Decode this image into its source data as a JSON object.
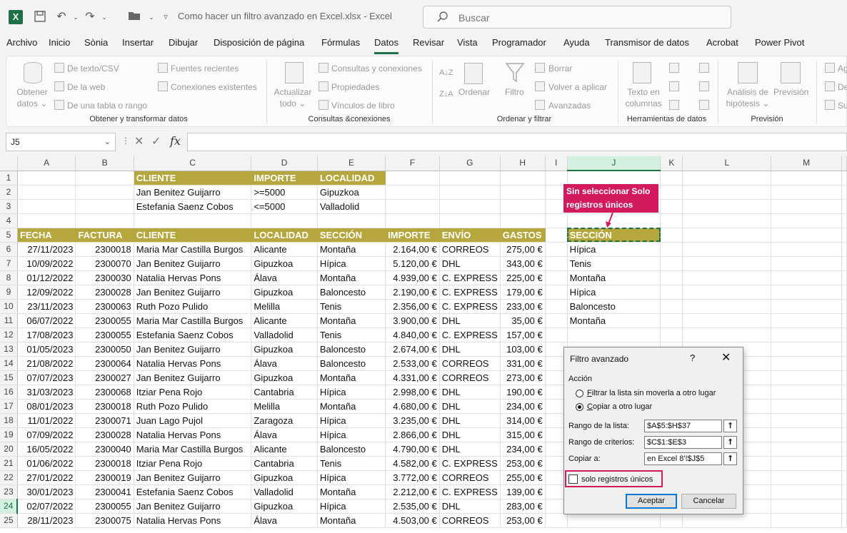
{
  "window": {
    "title": "Como hacer un filtro avanzado en Excel.xlsx  -  Excel",
    "search_placeholder": "Buscar"
  },
  "menu": [
    "Archivo",
    "Inicio",
    "Sònia",
    "Insertar",
    "Dibujar",
    "Disposición de página",
    "Fórmulas",
    "Datos",
    "Revisar",
    "Vista",
    "Programador",
    "Ayuda",
    "Transmisor de datos",
    "Acrobat",
    "Power Pivot"
  ],
  "menu_active": "Datos",
  "ribbon": {
    "obtener_datos_1": "Obtener",
    "obtener_datos_2": "datos ⌄",
    "de_texto": "De texto/CSV",
    "de_la_web": "De la web",
    "de_tabla": "De una tabla o rango",
    "fuentes_recientes": "Fuentes recientes",
    "conexiones_existentes": "Conexiones existentes",
    "group_obtener": "Obtener y transformar datos",
    "actualizar_1": "Actualizar",
    "actualizar_2": "todo ⌄",
    "consultas_conexiones": "Consultas y conexiones",
    "propiedades": "Propiedades",
    "vinculos": "Vínculos de libro",
    "group_consultas": "Consultas &conexiones",
    "ordenar": "Ordenar",
    "filtro": "Filtro",
    "borrar": "Borrar",
    "volver_aplicar": "Volver a aplicar",
    "avanzadas": "Avanzadas",
    "group_ordenar": "Ordenar y filtrar",
    "texto_columnas_1": "Texto en",
    "texto_columnas_2": "columnas",
    "group_herramientas": "Herramientas de datos",
    "analisis_1": "Análisis de",
    "analisis_2": "hipótesis ⌄",
    "prevision": "Previsión",
    "group_prevision": "Previsión",
    "ag": "Ag",
    "de": "De",
    "su": "Su"
  },
  "formula_bar": {
    "name_box": "J5",
    "fx": "fx",
    "formula": ""
  },
  "columns": [
    "A",
    "B",
    "C",
    "D",
    "E",
    "F",
    "G",
    "H",
    "I",
    "J",
    "K",
    "L",
    "M"
  ],
  "selected_column": "J",
  "selected_row": "24",
  "rows": [
    {
      "n": "1",
      "cells": [
        "",
        "",
        "CLIENTE",
        "IMPORTE",
        "LOCALIDAD",
        "",
        "",
        "",
        "",
        "",
        "",
        "",
        ""
      ]
    },
    {
      "n": "2",
      "cells": [
        "",
        "",
        "Jan Benitez Guijarro",
        ">=5000",
        "Gipuzkoa",
        "",
        "",
        "",
        "",
        "",
        "",
        "",
        ""
      ]
    },
    {
      "n": "3",
      "cells": [
        "",
        "",
        "Estefania Saenz Cobos",
        "<=5000",
        "Valladolid",
        "",
        "",
        "",
        "",
        "",
        "",
        "",
        ""
      ]
    },
    {
      "n": "4",
      "cells": [
        "",
        "",
        "",
        "",
        "",
        "",
        "",
        "",
        "",
        "",
        "",
        "",
        ""
      ]
    },
    {
      "n": "5",
      "cells": [
        "FECHA",
        "FACTURA",
        "CLIENTE",
        "LOCALIDAD",
        "SECCIÓN",
        "IMPORTE",
        "ENVÍO",
        "GASTOS",
        "",
        "SECCIÓN",
        "",
        "",
        ""
      ]
    },
    {
      "n": "6",
      "cells": [
        "27/11/2023",
        "2300018",
        "Maria Mar Castilla Burgos",
        "Alicante",
        "Montaña",
        "2.164,00 €",
        "CORREOS",
        "275,00 €",
        "",
        "Hípica",
        "",
        "",
        ""
      ]
    },
    {
      "n": "7",
      "cells": [
        "10/09/2022",
        "2300070",
        "Jan Benitez Guijarro",
        "Gipuzkoa",
        "Hípica",
        "5.120,00 €",
        "DHL",
        "343,00 €",
        "",
        "Tenis",
        "",
        "",
        ""
      ]
    },
    {
      "n": "8",
      "cells": [
        "01/12/2022",
        "2300030",
        "Natalia Hervas Pons",
        "Álava",
        "Montaña",
        "4.939,00 €",
        "C. EXPRESS",
        "225,00 €",
        "",
        "Montaña",
        "",
        "",
        ""
      ]
    },
    {
      "n": "9",
      "cells": [
        "12/09/2022",
        "2300028",
        "Jan Benitez Guijarro",
        "Gipuzkoa",
        "Baloncesto",
        "2.190,00 €",
        "C. EXPRESS",
        "179,00 €",
        "",
        "Hípica",
        "",
        "",
        ""
      ]
    },
    {
      "n": "10",
      "cells": [
        "23/11/2023",
        "2300063",
        "Ruth Pozo Pulido",
        "Melilla",
        "Tenis",
        "2.356,00 €",
        "C. EXPRESS",
        "233,00 €",
        "",
        "Baloncesto",
        "",
        "",
        ""
      ]
    },
    {
      "n": "11",
      "cells": [
        "06/07/2022",
        "2300055",
        "Maria Mar Castilla Burgos",
        "Alicante",
        "Montaña",
        "3.900,00 €",
        "DHL",
        "35,00 €",
        "",
        "Montaña",
        "",
        "",
        ""
      ]
    },
    {
      "n": "12",
      "cells": [
        "17/08/2023",
        "2300055",
        "Estefania Saenz Cobos",
        "Valladolid",
        "Tenis",
        "4.840,00 €",
        "C. EXPRESS",
        "157,00 €",
        "",
        "",
        "",
        "",
        ""
      ]
    },
    {
      "n": "13",
      "cells": [
        "01/05/2023",
        "2300050",
        "Jan Benitez Guijarro",
        "Gipuzkoa",
        "Baloncesto",
        "2.674,00 €",
        "DHL",
        "103,00 €",
        "",
        "",
        "",
        "",
        ""
      ]
    },
    {
      "n": "14",
      "cells": [
        "21/08/2022",
        "2300064",
        "Natalia Hervas Pons",
        "Álava",
        "Baloncesto",
        "2.533,00 €",
        "CORREOS",
        "331,00 €",
        "",
        "",
        "",
        "",
        ""
      ]
    },
    {
      "n": "15",
      "cells": [
        "07/07/2023",
        "2300027",
        "Jan Benitez Guijarro",
        "Gipuzkoa",
        "Montaña",
        "4.331,00 €",
        "CORREOS",
        "273,00 €",
        "",
        "",
        "",
        "",
        ""
      ]
    },
    {
      "n": "16",
      "cells": [
        "31/03/2023",
        "2300068",
        "Itziar Pena Rojo",
        "Cantabria",
        "Hípica",
        "2.998,00 €",
        "DHL",
        "190,00 €",
        "",
        "",
        "",
        "",
        ""
      ]
    },
    {
      "n": "17",
      "cells": [
        "08/01/2023",
        "2300018",
        "Ruth Pozo Pulido",
        "Melilla",
        "Montaña",
        "4.680,00 €",
        "DHL",
        "234,00 €",
        "",
        "",
        "",
        "",
        ""
      ]
    },
    {
      "n": "18",
      "cells": [
        "11/01/2022",
        "2300071",
        "Juan Lago Pujol",
        "Zaragoza",
        "Hípica",
        "3.235,00 €",
        "DHL",
        "314,00 €",
        "",
        "",
        "",
        "",
        ""
      ]
    },
    {
      "n": "19",
      "cells": [
        "07/09/2022",
        "2300028",
        "Natalia Hervas Pons",
        "Álava",
        "Hípica",
        "2.866,00 €",
        "DHL",
        "315,00 €",
        "",
        "",
        "",
        "",
        ""
      ]
    },
    {
      "n": "20",
      "cells": [
        "16/05/2022",
        "2300040",
        "Maria Mar Castilla Burgos",
        "Alicante",
        "Baloncesto",
        "4.790,00 €",
        "DHL",
        "234,00 €",
        "",
        "",
        "",
        "",
        ""
      ]
    },
    {
      "n": "21",
      "cells": [
        "01/06/2022",
        "2300018",
        "Itziar Pena Rojo",
        "Cantabria",
        "Tenis",
        "4.582,00 €",
        "C. EXPRESS",
        "253,00 €",
        "",
        "",
        "",
        "",
        ""
      ]
    },
    {
      "n": "22",
      "cells": [
        "27/01/2022",
        "2300019",
        "Jan Benitez Guijarro",
        "Gipuzkoa",
        "Hípica",
        "3.772,00 €",
        "CORREOS",
        "255,00 €",
        "",
        "",
        "",
        "",
        ""
      ]
    },
    {
      "n": "23",
      "cells": [
        "30/01/2023",
        "2300041",
        "Estefania Saenz Cobos",
        "Valladolid",
        "Montaña",
        "2.212,00 €",
        "C. EXPRESS",
        "139,00 €",
        "",
        "",
        "",
        "",
        ""
      ]
    },
    {
      "n": "24",
      "cells": [
        "02/07/2022",
        "2300055",
        "Jan Benitez Guijarro",
        "Gipuzkoa",
        "Hípica",
        "2.535,00 €",
        "DHL",
        "283,00 €",
        "",
        "",
        "",
        "",
        ""
      ]
    },
    {
      "n": "25",
      "cells": [
        "28/11/2023",
        "2300075",
        "Natalia Hervas Pons",
        "Álava",
        "Montaña",
        "4.503,00 €",
        "CORREOS",
        "253,00 €",
        "",
        "",
        "",
        "",
        ""
      ]
    }
  ],
  "callout": "Sin seleccionar Solo registros únicos",
  "dialog": {
    "title": "Filtro avanzado",
    "help": "?",
    "close": "✕",
    "section": "Acción",
    "radio1": "Filtrar la lista sin moverla a otro lugar",
    "radio2": "Copiar a otro lugar",
    "rango_lista_label": "Rango de la lista:",
    "rango_lista_value": "$A$5:$H$37",
    "rango_criterios_label": "Rango de criterios:",
    "rango_criterios_value": "$C$1:$E$3",
    "copiar_label": "Copiar a:",
    "copiar_value": "en Excel 8'!$J$5",
    "checkbox_label": "solo registros únicos",
    "ok": "Aceptar",
    "cancel": "Cancelar"
  },
  "colors": {
    "header_fill": "#b5a73b",
    "accent": "#1e7145",
    "callout": "#d41a5e"
  }
}
